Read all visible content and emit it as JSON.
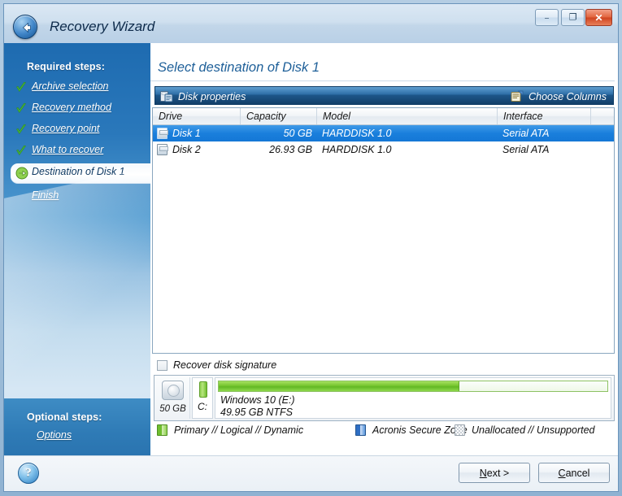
{
  "window": {
    "title": "Recovery Wizard",
    "back_icon": "back-arrow-icon",
    "controls": {
      "minimize": "–",
      "maximize": "❐",
      "close": "✕"
    }
  },
  "sidebar": {
    "required_heading": "Required steps:",
    "optional_heading": "Optional steps:",
    "steps": [
      {
        "label": "Archive selection",
        "state": "done",
        "icon": "green-check-icon"
      },
      {
        "label": "Recovery method",
        "state": "done",
        "icon": "green-check-icon"
      },
      {
        "label": "Recovery point",
        "state": "done",
        "icon": "green-check-icon"
      },
      {
        "label": "What to recover",
        "state": "done",
        "icon": "green-check-icon"
      },
      {
        "label": "Destination of Disk 1",
        "state": "current",
        "icon": "green-arrow-icon"
      },
      {
        "label": "Finish",
        "state": "pending",
        "icon": "none"
      }
    ],
    "optional_link": "Options"
  },
  "main": {
    "page_title": "Select destination of Disk 1",
    "toolbar": {
      "disk_properties": "Disk properties",
      "disk_properties_icon": "disk-properties-icon",
      "choose_columns": "Choose Columns",
      "choose_columns_icon": "choose-columns-icon"
    },
    "table": {
      "columns": [
        "Drive",
        "Capacity",
        "Model",
        "Interface",
        ""
      ],
      "rows": [
        {
          "drive": "Disk 1",
          "capacity": "50 GB",
          "model": "HARDDISK 1.0",
          "interface": "Serial ATA",
          "selected": true
        },
        {
          "drive": "Disk 2",
          "capacity": "26.93 GB",
          "model": "HARDDISK 1.0",
          "interface": "Serial ATA",
          "selected": false
        }
      ]
    },
    "checkbox": {
      "label": "Recover disk signature",
      "checked": false
    },
    "disk_map": {
      "disk_size": "50 GB",
      "drive_letter": "C:",
      "volume_name": "Windows 10 (E:)",
      "volume_info": "49.95 GB  NTFS",
      "used_percent": 62
    },
    "legend": [
      {
        "label": "Primary // Logical // Dynamic",
        "swatch": "green"
      },
      {
        "label": "Acronis Secure Zone",
        "swatch": "blue"
      },
      {
        "label": "Unallocated // Unsupported",
        "swatch": "grey"
      }
    ]
  },
  "footer": {
    "help_icon": "help-question-icon",
    "next_label": "Next >",
    "cancel_label": "Cancel"
  },
  "colors": {
    "accent_blue": "#1f6099",
    "selection_blue": "#1a7fdc",
    "green": "#6fbe2e",
    "title_text": "#0d2a4a"
  }
}
